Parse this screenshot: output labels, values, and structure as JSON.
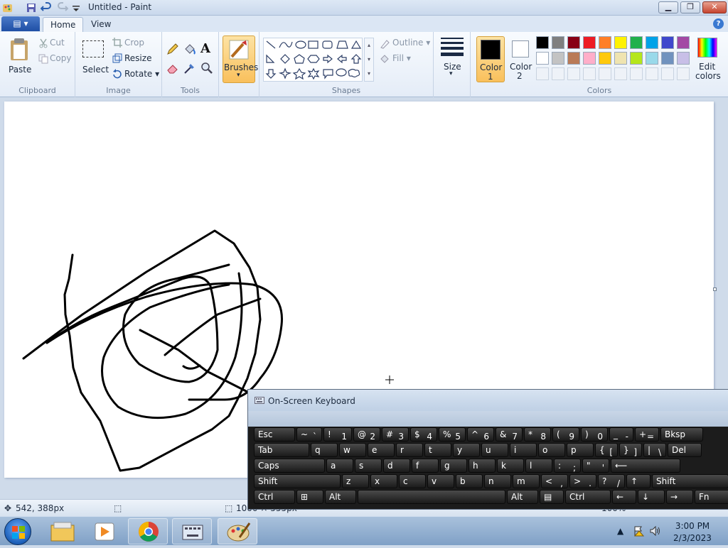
{
  "window": {
    "title": "Untitled - Paint"
  },
  "tabs": {
    "file_label": "",
    "home": "Home",
    "view": "View"
  },
  "ribbon": {
    "clipboard": {
      "group": "Clipboard",
      "paste": "Paste",
      "cut": "Cut",
      "copy": "Copy"
    },
    "image": {
      "group": "Image",
      "select": "Select",
      "crop": "Crop",
      "resize": "Resize",
      "rotate": "Rotate"
    },
    "tools": {
      "group": "Tools"
    },
    "brushes": {
      "label": "Brushes"
    },
    "shapes": {
      "group": "Shapes",
      "outline": "Outline",
      "fill": "Fill"
    },
    "size": {
      "label": "Size"
    },
    "colors": {
      "group": "Colors",
      "color1_a": "Color",
      "color1_b": "1",
      "color2_a": "Color",
      "color2_b": "2",
      "edit_a": "Edit",
      "edit_b": "colors",
      "palette_row1": [
        "#000000",
        "#7f7f7f",
        "#880015",
        "#ed1c24",
        "#ff7f27",
        "#fff200",
        "#22b14c",
        "#00a2e8",
        "#3f48cc",
        "#a349a4"
      ],
      "palette_row2": [
        "#ffffff",
        "#c3c3c3",
        "#b97a57",
        "#ffaec9",
        "#ffc90e",
        "#efe4b0",
        "#b5e61d",
        "#99d9ea",
        "#7092be",
        "#c8bfe7"
      ]
    }
  },
  "status": {
    "cursor_pos": "542, 388px",
    "image_size": "1000 × 555px",
    "zoom": "100%"
  },
  "osk": {
    "title": "On-Screen Keyboard",
    "row1": [
      {
        "a": "Esc",
        "b": ""
      },
      {
        "a": "~",
        "b": "`"
      },
      {
        "a": "!",
        "b": "1"
      },
      {
        "a": "@",
        "b": "2"
      },
      {
        "a": "#",
        "b": "3"
      },
      {
        "a": "$",
        "b": "4"
      },
      {
        "a": "%",
        "b": "5"
      },
      {
        "a": "^",
        "b": "6"
      },
      {
        "a": "&",
        "b": "7"
      },
      {
        "a": "*",
        "b": "8"
      },
      {
        "a": "(",
        "b": "9"
      },
      {
        "a": ")",
        "b": "0"
      },
      {
        "a": "_",
        "b": "-"
      },
      {
        "a": "+",
        "b": "="
      },
      {
        "a": "Bksp",
        "b": ""
      }
    ],
    "row2": [
      {
        "a": "Tab",
        "b": ""
      },
      {
        "a": "q",
        "b": ""
      },
      {
        "a": "w",
        "b": ""
      },
      {
        "a": "e",
        "b": ""
      },
      {
        "a": "r",
        "b": ""
      },
      {
        "a": "t",
        "b": ""
      },
      {
        "a": "y",
        "b": ""
      },
      {
        "a": "u",
        "b": ""
      },
      {
        "a": "i",
        "b": ""
      },
      {
        "a": "o",
        "b": ""
      },
      {
        "a": "p",
        "b": ""
      },
      {
        "a": "{",
        "b": "["
      },
      {
        "a": "}",
        "b": "]"
      },
      {
        "a": "|",
        "b": "\\"
      },
      {
        "a": "Del",
        "b": ""
      }
    ],
    "row3": [
      {
        "a": "Caps",
        "b": ""
      },
      {
        "a": "a",
        "b": ""
      },
      {
        "a": "s",
        "b": ""
      },
      {
        "a": "d",
        "b": ""
      },
      {
        "a": "f",
        "b": ""
      },
      {
        "a": "g",
        "b": ""
      },
      {
        "a": "h",
        "b": ""
      },
      {
        "a": "k",
        "b": ""
      },
      {
        "a": "l",
        "b": ""
      },
      {
        "a": ":",
        "b": ";"
      },
      {
        "a": "\"",
        "b": "'"
      },
      {
        "a": "⟵",
        "b": ""
      }
    ],
    "row4": [
      {
        "a": "Shift",
        "b": ""
      },
      {
        "a": "z",
        "b": ""
      },
      {
        "a": "x",
        "b": ""
      },
      {
        "a": "c",
        "b": ""
      },
      {
        "a": "v",
        "b": ""
      },
      {
        "a": "b",
        "b": ""
      },
      {
        "a": "n",
        "b": ""
      },
      {
        "a": "m",
        "b": ""
      },
      {
        "a": "<",
        "b": ","
      },
      {
        "a": ">",
        "b": "."
      },
      {
        "a": "?",
        "b": "/"
      },
      {
        "a": "↑",
        "b": ""
      },
      {
        "a": "Shift",
        "b": ""
      }
    ],
    "row5": [
      {
        "a": "Ctrl",
        "b": ""
      },
      {
        "a": "⊞",
        "b": ""
      },
      {
        "a": "Alt",
        "b": ""
      },
      {
        "a": "",
        "b": ""
      },
      {
        "a": "Alt",
        "b": ""
      },
      {
        "a": "▤",
        "b": ""
      },
      {
        "a": "Ctrl",
        "b": ""
      },
      {
        "a": "←",
        "b": ""
      },
      {
        "a": "↓",
        "b": ""
      },
      {
        "a": "→",
        "b": ""
      },
      {
        "a": "Fn",
        "b": ""
      }
    ]
  },
  "taskbar": {
    "time": "3:00 PM",
    "date": "2/3/2023"
  }
}
